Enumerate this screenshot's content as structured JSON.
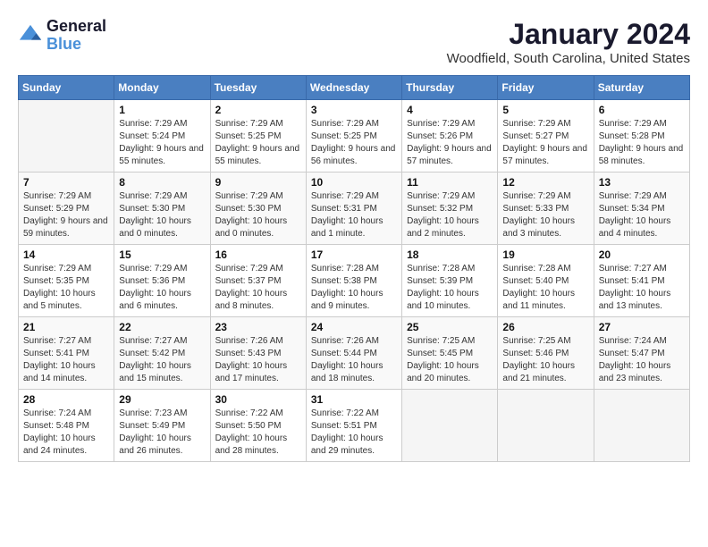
{
  "header": {
    "logo": {
      "line1": "General",
      "line2": "Blue"
    },
    "title": "January 2024",
    "location": "Woodfield, South Carolina, United States"
  },
  "weekdays": [
    "Sunday",
    "Monday",
    "Tuesday",
    "Wednesday",
    "Thursday",
    "Friday",
    "Saturday"
  ],
  "weeks": [
    [
      {
        "day": null,
        "sunrise": "",
        "sunset": "",
        "daylight": ""
      },
      {
        "day": "1",
        "sunrise": "Sunrise: 7:29 AM",
        "sunset": "Sunset: 5:24 PM",
        "daylight": "Daylight: 9 hours and 55 minutes."
      },
      {
        "day": "2",
        "sunrise": "Sunrise: 7:29 AM",
        "sunset": "Sunset: 5:25 PM",
        "daylight": "Daylight: 9 hours and 55 minutes."
      },
      {
        "day": "3",
        "sunrise": "Sunrise: 7:29 AM",
        "sunset": "Sunset: 5:25 PM",
        "daylight": "Daylight: 9 hours and 56 minutes."
      },
      {
        "day": "4",
        "sunrise": "Sunrise: 7:29 AM",
        "sunset": "Sunset: 5:26 PM",
        "daylight": "Daylight: 9 hours and 57 minutes."
      },
      {
        "day": "5",
        "sunrise": "Sunrise: 7:29 AM",
        "sunset": "Sunset: 5:27 PM",
        "daylight": "Daylight: 9 hours and 57 minutes."
      },
      {
        "day": "6",
        "sunrise": "Sunrise: 7:29 AM",
        "sunset": "Sunset: 5:28 PM",
        "daylight": "Daylight: 9 hours and 58 minutes."
      }
    ],
    [
      {
        "day": "7",
        "sunrise": "Sunrise: 7:29 AM",
        "sunset": "Sunset: 5:29 PM",
        "daylight": "Daylight: 9 hours and 59 minutes."
      },
      {
        "day": "8",
        "sunrise": "Sunrise: 7:29 AM",
        "sunset": "Sunset: 5:30 PM",
        "daylight": "Daylight: 10 hours and 0 minutes."
      },
      {
        "day": "9",
        "sunrise": "Sunrise: 7:29 AM",
        "sunset": "Sunset: 5:30 PM",
        "daylight": "Daylight: 10 hours and 0 minutes."
      },
      {
        "day": "10",
        "sunrise": "Sunrise: 7:29 AM",
        "sunset": "Sunset: 5:31 PM",
        "daylight": "Daylight: 10 hours and 1 minute."
      },
      {
        "day": "11",
        "sunrise": "Sunrise: 7:29 AM",
        "sunset": "Sunset: 5:32 PM",
        "daylight": "Daylight: 10 hours and 2 minutes."
      },
      {
        "day": "12",
        "sunrise": "Sunrise: 7:29 AM",
        "sunset": "Sunset: 5:33 PM",
        "daylight": "Daylight: 10 hours and 3 minutes."
      },
      {
        "day": "13",
        "sunrise": "Sunrise: 7:29 AM",
        "sunset": "Sunset: 5:34 PM",
        "daylight": "Daylight: 10 hours and 4 minutes."
      }
    ],
    [
      {
        "day": "14",
        "sunrise": "Sunrise: 7:29 AM",
        "sunset": "Sunset: 5:35 PM",
        "daylight": "Daylight: 10 hours and 5 minutes."
      },
      {
        "day": "15",
        "sunrise": "Sunrise: 7:29 AM",
        "sunset": "Sunset: 5:36 PM",
        "daylight": "Daylight: 10 hours and 6 minutes."
      },
      {
        "day": "16",
        "sunrise": "Sunrise: 7:29 AM",
        "sunset": "Sunset: 5:37 PM",
        "daylight": "Daylight: 10 hours and 8 minutes."
      },
      {
        "day": "17",
        "sunrise": "Sunrise: 7:28 AM",
        "sunset": "Sunset: 5:38 PM",
        "daylight": "Daylight: 10 hours and 9 minutes."
      },
      {
        "day": "18",
        "sunrise": "Sunrise: 7:28 AM",
        "sunset": "Sunset: 5:39 PM",
        "daylight": "Daylight: 10 hours and 10 minutes."
      },
      {
        "day": "19",
        "sunrise": "Sunrise: 7:28 AM",
        "sunset": "Sunset: 5:40 PM",
        "daylight": "Daylight: 10 hours and 11 minutes."
      },
      {
        "day": "20",
        "sunrise": "Sunrise: 7:27 AM",
        "sunset": "Sunset: 5:41 PM",
        "daylight": "Daylight: 10 hours and 13 minutes."
      }
    ],
    [
      {
        "day": "21",
        "sunrise": "Sunrise: 7:27 AM",
        "sunset": "Sunset: 5:41 PM",
        "daylight": "Daylight: 10 hours and 14 minutes."
      },
      {
        "day": "22",
        "sunrise": "Sunrise: 7:27 AM",
        "sunset": "Sunset: 5:42 PM",
        "daylight": "Daylight: 10 hours and 15 minutes."
      },
      {
        "day": "23",
        "sunrise": "Sunrise: 7:26 AM",
        "sunset": "Sunset: 5:43 PM",
        "daylight": "Daylight: 10 hours and 17 minutes."
      },
      {
        "day": "24",
        "sunrise": "Sunrise: 7:26 AM",
        "sunset": "Sunset: 5:44 PM",
        "daylight": "Daylight: 10 hours and 18 minutes."
      },
      {
        "day": "25",
        "sunrise": "Sunrise: 7:25 AM",
        "sunset": "Sunset: 5:45 PM",
        "daylight": "Daylight: 10 hours and 20 minutes."
      },
      {
        "day": "26",
        "sunrise": "Sunrise: 7:25 AM",
        "sunset": "Sunset: 5:46 PM",
        "daylight": "Daylight: 10 hours and 21 minutes."
      },
      {
        "day": "27",
        "sunrise": "Sunrise: 7:24 AM",
        "sunset": "Sunset: 5:47 PM",
        "daylight": "Daylight: 10 hours and 23 minutes."
      }
    ],
    [
      {
        "day": "28",
        "sunrise": "Sunrise: 7:24 AM",
        "sunset": "Sunset: 5:48 PM",
        "daylight": "Daylight: 10 hours and 24 minutes."
      },
      {
        "day": "29",
        "sunrise": "Sunrise: 7:23 AM",
        "sunset": "Sunset: 5:49 PM",
        "daylight": "Daylight: 10 hours and 26 minutes."
      },
      {
        "day": "30",
        "sunrise": "Sunrise: 7:22 AM",
        "sunset": "Sunset: 5:50 PM",
        "daylight": "Daylight: 10 hours and 28 minutes."
      },
      {
        "day": "31",
        "sunrise": "Sunrise: 7:22 AM",
        "sunset": "Sunset: 5:51 PM",
        "daylight": "Daylight: 10 hours and 29 minutes."
      },
      {
        "day": null,
        "sunrise": "",
        "sunset": "",
        "daylight": ""
      },
      {
        "day": null,
        "sunrise": "",
        "sunset": "",
        "daylight": ""
      },
      {
        "day": null,
        "sunrise": "",
        "sunset": "",
        "daylight": ""
      }
    ]
  ]
}
